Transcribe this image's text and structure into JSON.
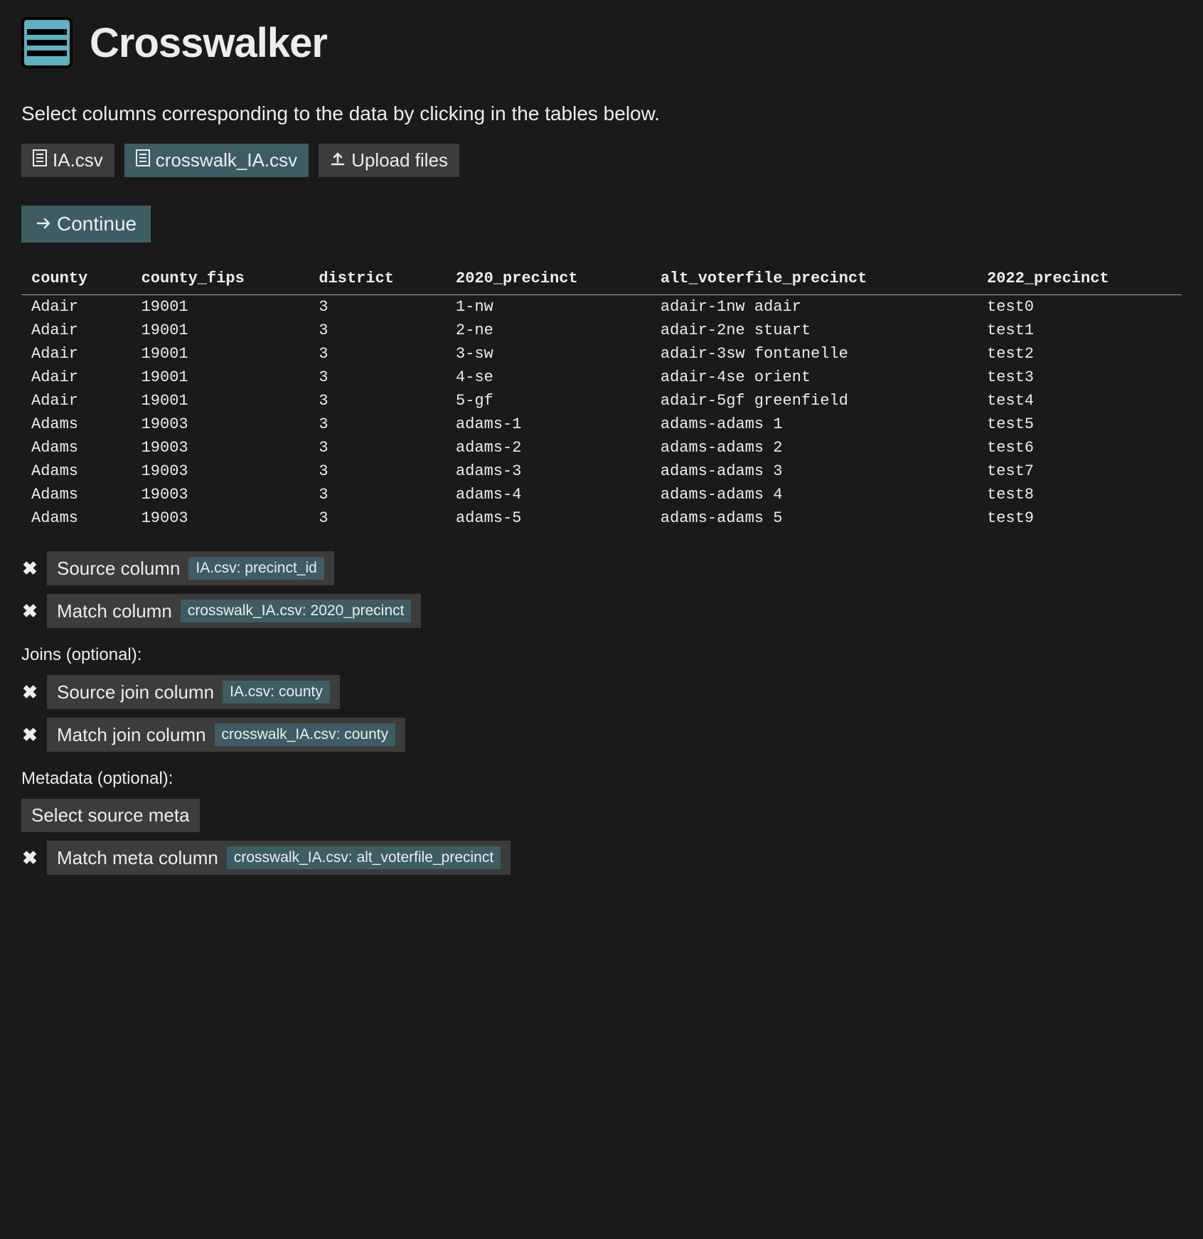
{
  "app_title": "Crosswalker",
  "instruction": "Select columns corresponding to the data by clicking in the tables below.",
  "tabs": [
    {
      "label": "IA.csv",
      "active": false
    },
    {
      "label": "crosswalk_IA.csv",
      "active": true
    }
  ],
  "upload_label": "Upload files",
  "continue_label": "Continue",
  "table": {
    "headers": [
      "county",
      "county_fips",
      "district",
      "2020_precinct",
      "alt_voterfile_precinct",
      "2022_precinct"
    ],
    "rows": [
      [
        "Adair",
        "19001",
        "3",
        "1-nw",
        "adair-1nw adair",
        "test0"
      ],
      [
        "Adair",
        "19001",
        "3",
        "2-ne",
        "adair-2ne stuart",
        "test1"
      ],
      [
        "Adair",
        "19001",
        "3",
        "3-sw",
        "adair-3sw fontanelle",
        "test2"
      ],
      [
        "Adair",
        "19001",
        "3",
        "4-se",
        "adair-4se orient",
        "test3"
      ],
      [
        "Adair",
        "19001",
        "3",
        "5-gf",
        "adair-5gf greenfield",
        "test4"
      ],
      [
        "Adams",
        "19003",
        "3",
        "adams-1",
        "adams-adams 1",
        "test5"
      ],
      [
        "Adams",
        "19003",
        "3",
        "adams-2",
        "adams-adams 2",
        "test6"
      ],
      [
        "Adams",
        "19003",
        "3",
        "adams-3",
        "adams-adams 3",
        "test7"
      ],
      [
        "Adams",
        "19003",
        "3",
        "adams-4",
        "adams-adams 4",
        "test8"
      ],
      [
        "Adams",
        "19003",
        "3",
        "adams-5",
        "adams-adams 5",
        "test9"
      ]
    ]
  },
  "selections": {
    "source_column": {
      "label": "Source column",
      "badge": "IA.csv: precinct_id"
    },
    "match_column": {
      "label": "Match column",
      "badge": "crosswalk_IA.csv: 2020_precinct"
    },
    "joins_heading": "Joins (optional):",
    "source_join": {
      "label": "Source join column",
      "badge": "IA.csv: county"
    },
    "match_join": {
      "label": "Match join column",
      "badge": "crosswalk_IA.csv: county"
    },
    "metadata_heading": "Metadata (optional):",
    "source_meta": {
      "label": "Select source meta"
    },
    "match_meta": {
      "label": "Match meta column",
      "badge": "crosswalk_IA.csv: alt_voterfile_precinct"
    }
  }
}
